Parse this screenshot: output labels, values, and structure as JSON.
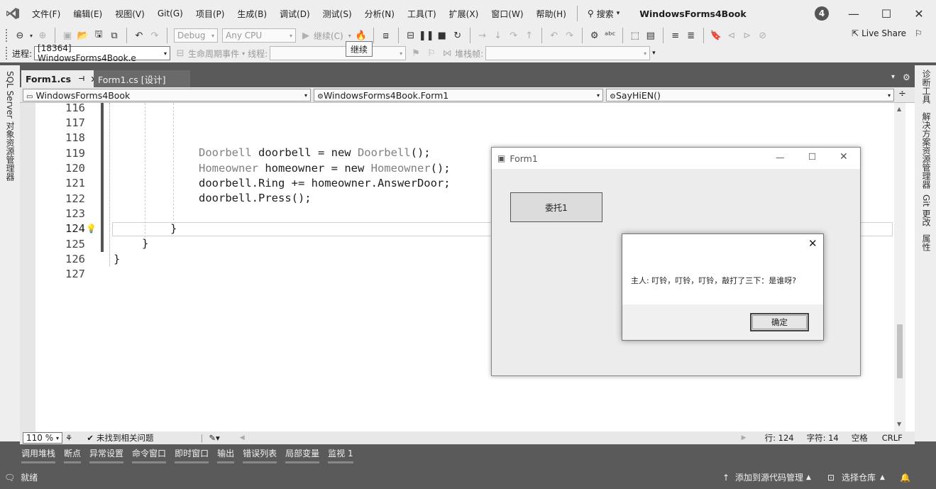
{
  "titlebar": {
    "menu": [
      "文件(F)",
      "编辑(E)",
      "视图(V)",
      "Git(G)",
      "项目(P)",
      "生成(B)",
      "调试(D)",
      "测试(S)",
      "分析(N)",
      "工具(T)",
      "扩展(X)",
      "窗口(W)",
      "帮助(H)"
    ],
    "search": "搜索",
    "app_title": "WindowsForms4Book",
    "badge": "4"
  },
  "toolbar": {
    "config": "Debug",
    "platform": "Any CPU",
    "continue_label": "继续(C)",
    "live_share": "Live Share",
    "tooltip": "继续"
  },
  "debugbar": {
    "process_label": "进程:",
    "process_value": "[18364] WindowsForms4Book.e",
    "lifecycle": "生命周期事件",
    "thread_label": "线程:",
    "stackframe_label": "堆栈帧:"
  },
  "side": {
    "left": "SQL Server 对象资源管理器",
    "right": [
      "诊断工具",
      "解决方案资源管理器",
      "Git 更改",
      "属性"
    ]
  },
  "tabs": [
    {
      "label": "Form1.cs"
    },
    {
      "label": "Form1.cs [设计]"
    }
  ],
  "navbar": {
    "project": "WindowsForms4Book",
    "class": "WindowsForms4Book.Form1",
    "member": "SayHiEN()"
  },
  "code": {
    "line_numbers": [
      "116",
      "117",
      "118",
      "119",
      "120",
      "121",
      "122",
      "123",
      "124",
      "125",
      "126",
      "127"
    ],
    "l119_type": "Doorbell",
    "l119_rest": " doorbell = new ",
    "l119_type2": "Doorbell",
    "l119_end": "();",
    "l120_type": "Homeowner",
    "l120_rest": " homeowner = new ",
    "l120_type2": "Homeowner",
    "l120_end": "();",
    "l121": "doorbell.Ring += homeowner.AnswerDoor;",
    "l122": "doorbell.Press();",
    "l124": "}",
    "l125": "}",
    "l126": "}"
  },
  "editor_status": {
    "zoom": "110 %",
    "issues": "未找到相关问题",
    "line": "行: 124",
    "col": "字符: 14",
    "spaces": "空格",
    "eol": "CRLF"
  },
  "tool_tabs": [
    "调用堆栈",
    "断点",
    "异常设置",
    "命令窗口",
    "即时窗口",
    "输出",
    "错误列表",
    "局部变量",
    "监视 1"
  ],
  "statusbar": {
    "ready": "就绪",
    "add_source": "添加到源代码管理",
    "select_repo": "选择仓库"
  },
  "form1": {
    "title": "Form1",
    "button": "委托1"
  },
  "msgbox": {
    "text": "主人: 叮铃，叮铃，叮铃，敲打了三下：是谁呀?",
    "ok": "确定"
  }
}
